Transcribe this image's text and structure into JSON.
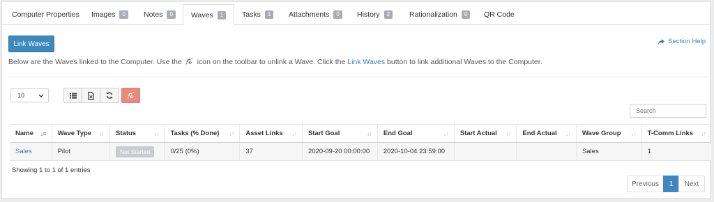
{
  "tabs": [
    {
      "label": "Computer Properties",
      "count": null
    },
    {
      "label": "Images",
      "count": "0"
    },
    {
      "label": "Notes",
      "count": "0"
    },
    {
      "label": "Waves",
      "count": "1"
    },
    {
      "label": "Tasks",
      "count": "1"
    },
    {
      "label": "Attachments",
      "count": "0"
    },
    {
      "label": "History",
      "count": "2"
    },
    {
      "label": "Rationalization",
      "count": "0"
    },
    {
      "label": "QR Code",
      "count": null
    }
  ],
  "active_tab": "Waves",
  "link_waves_button": "Link Waves",
  "section_help": "Section Help",
  "info": {
    "part1": "Below are the Waves linked to the Computer. Use the",
    "part2": "icon on the toolbar to unlink a Wave. Click the",
    "link": "Link Waves",
    "part3": "button to link additional Waves to the Computer."
  },
  "page_size": "10",
  "search_placeholder": "Search",
  "table": {
    "columns": [
      "Name",
      "Wave Type",
      "Status",
      "Tasks (% Done)",
      "Asset Links",
      "Start Goal",
      "End Goal",
      "Start Actual",
      "End Actual",
      "Wave Group",
      "T-Comm Links"
    ],
    "rows": [
      {
        "name": "Sales",
        "wave_type": "Pilot",
        "status": "Not Started",
        "tasks_done": "0/25 (0%)",
        "asset_links": "37",
        "start_goal": "2020-09-20 00:00:00",
        "end_goal": "2020-10-04 23:59:00",
        "start_actual": "",
        "end_actual": "",
        "wave_group": "Sales",
        "tcomm_links": "1"
      }
    ]
  },
  "showing": "Showing 1 to 1 of 1 entries",
  "pagination": {
    "previous": "Previous",
    "current": "1",
    "next": "Next"
  },
  "colors": {
    "primary": "#3e88bf",
    "link": "#3c7fb6",
    "unlink_button": "#ea8a7d",
    "badge": "#a9adb1"
  }
}
